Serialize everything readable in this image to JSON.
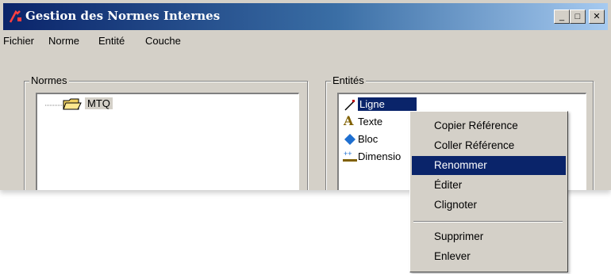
{
  "window": {
    "title": "Gestion des Normes Internes",
    "buttons": [
      "minimize",
      "maximize",
      "close"
    ],
    "colors": {
      "titlebar_start": "#0a246a",
      "titlebar_end": "#a6caf0",
      "face": "#d4d0c8",
      "selection": "#0a246a"
    }
  },
  "menu": {
    "items": [
      "Fichier",
      "Norme",
      "Entité",
      "Couche"
    ]
  },
  "normes": {
    "label": "Normes",
    "tree": {
      "root": "MTQ",
      "icon": "folder-open-icon"
    }
  },
  "entites": {
    "label": "Entités",
    "items": [
      {
        "label": "Ligne",
        "icon": "line-icon",
        "selected": true
      },
      {
        "label": "Texte",
        "icon": "text-a-icon"
      },
      {
        "label": "Bloc",
        "icon": "block-diamond-icon"
      },
      {
        "label": "Dimensio",
        "icon": "dimension-icon"
      }
    ]
  },
  "context_menu": {
    "items": [
      {
        "label": "Copier  Référence"
      },
      {
        "label": "Coller Référence"
      },
      {
        "label": "Renommer",
        "highlighted": true
      },
      {
        "label": "Éditer"
      },
      {
        "label": "Clignoter"
      },
      {
        "label": "Supprimer"
      },
      {
        "label": "Enlever"
      }
    ]
  }
}
